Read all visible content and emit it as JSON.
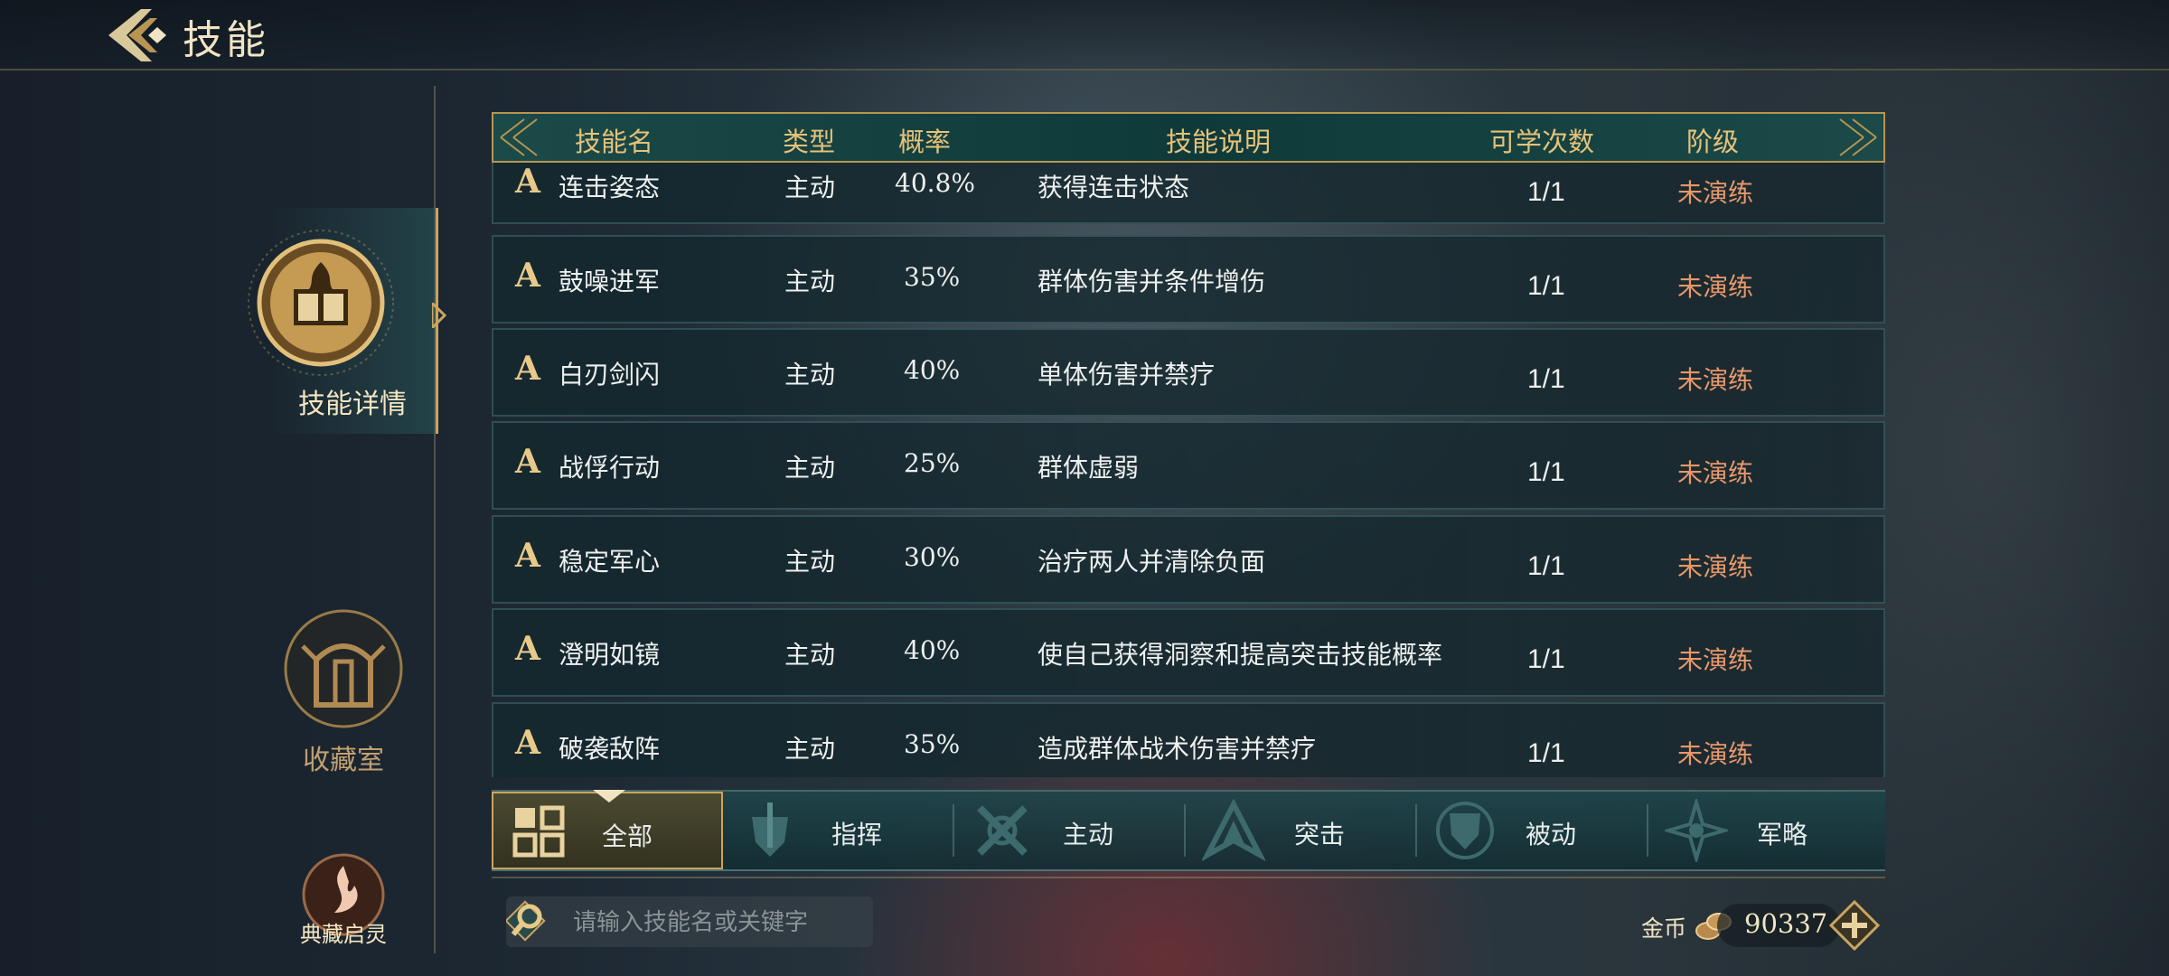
{
  "header": {
    "title": "技能"
  },
  "sidebar": {
    "items": [
      {
        "label": "技能详情",
        "active": true,
        "icon": "skill-book-icon"
      },
      {
        "label": "收藏室",
        "active": false,
        "icon": "collection-hall-icon"
      },
      {
        "label": "典藏启灵",
        "active": false,
        "icon": "flame-spirit-icon"
      }
    ]
  },
  "table": {
    "columns": [
      "技能名",
      "类型",
      "概率",
      "技能说明",
      "可学次数",
      "阶级"
    ],
    "rows": [
      {
        "grade": "A",
        "name": "连击姿态",
        "type": "主动",
        "rate": "40.8%",
        "desc": "获得连击状态",
        "count": "1/1",
        "stage": "未演练"
      },
      {
        "grade": "A",
        "name": "鼓噪进军",
        "type": "主动",
        "rate": "35%",
        "desc": "群体伤害并条件增伤",
        "count": "1/1",
        "stage": "未演练"
      },
      {
        "grade": "A",
        "name": "白刃剑闪",
        "type": "主动",
        "rate": "40%",
        "desc": "单体伤害并禁疗",
        "count": "1/1",
        "stage": "未演练"
      },
      {
        "grade": "A",
        "name": "战俘行动",
        "type": "主动",
        "rate": "25%",
        "desc": "群体虚弱",
        "count": "1/1",
        "stage": "未演练"
      },
      {
        "grade": "A",
        "name": "稳定军心",
        "type": "主动",
        "rate": "30%",
        "desc": "治疗两人并清除负面",
        "count": "1/1",
        "stage": "未演练"
      },
      {
        "grade": "A",
        "name": "澄明如镜",
        "type": "主动",
        "rate": "40%",
        "desc": "使自己获得洞察和提高突击技能概率",
        "count": "1/1",
        "stage": "未演练"
      },
      {
        "grade": "A",
        "name": "破袭敌阵",
        "type": "主动",
        "rate": "35%",
        "desc": "造成群体战术伤害并禁疗",
        "count": "1/1",
        "stage": "未演练"
      }
    ]
  },
  "filters": {
    "selected": "全部",
    "tabs": [
      {
        "label": "全部",
        "icon": "grid-icon"
      },
      {
        "label": "指挥",
        "icon": "sword-shield-icon"
      },
      {
        "label": "主动",
        "icon": "crossed-swords-icon"
      },
      {
        "label": "突击",
        "icon": "assault-icon"
      },
      {
        "label": "被动",
        "icon": "shield-icon"
      },
      {
        "label": "军略",
        "icon": "strategy-star-icon"
      }
    ]
  },
  "search": {
    "placeholder": "请输入技能名或关键字",
    "value": ""
  },
  "currency": {
    "label": "金币",
    "value": "90337"
  },
  "colors": {
    "gold": "#caa460",
    "stage": "#e8976a",
    "teal": "#1b4a48"
  }
}
